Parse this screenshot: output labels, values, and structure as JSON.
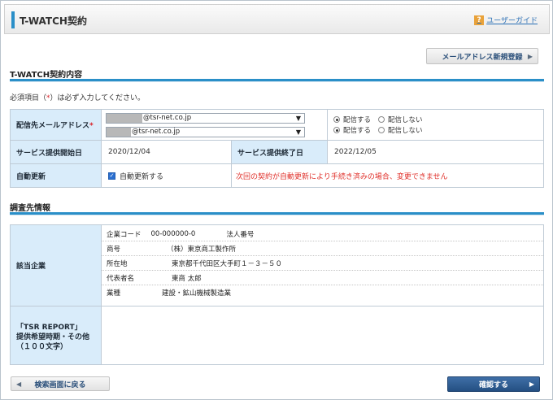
{
  "header": {
    "title": "T-WATCH契約",
    "guide_label": "ユーザーガイド",
    "guide_icon": "?"
  },
  "register_button": "メールアドレス新規登録",
  "contract_section": {
    "title": "T-WATCH契約内容"
  },
  "required_note": {
    "prefix": "必須項目（",
    "mark": "*",
    "suffix": "）は必ず入力してください。"
  },
  "contract_table": {
    "email_label": "配信先メールアドレス",
    "required_mark": "*",
    "emails": [
      {
        "value": "@tsr-net.co.jp",
        "radio_on": "配信する",
        "radio_off": "配信しない"
      },
      {
        "value": "@tsr-net.co.jp",
        "radio_on": "配信する",
        "radio_off": "配信しない"
      }
    ],
    "start_label": "サービス提供開始日",
    "start_value": "2020/12/04",
    "end_label": "サービス提供終了日",
    "end_value": "2022/12/05",
    "auto_label": "自動更新",
    "auto_checkbox_label": "自動更新する",
    "auto_warning": "次回の契約が自動更新により手続き済みの場合、変更できません"
  },
  "survey_section": {
    "title": "調査先情報"
  },
  "company": {
    "label": "該当企業",
    "code_label": "企業コード",
    "code_value": "00-000000-0",
    "corp_no_label": "法人番号",
    "rows": [
      {
        "key": "商号",
        "value": "（株）東京商工製作所"
      },
      {
        "key": "所在地",
        "value": "東京都千代田区大手町１－３－５０"
      },
      {
        "key": "代表者名",
        "value": "東商 太郎"
      },
      {
        "key": "業種",
        "value": "建設・鉱山機械製造業"
      }
    ]
  },
  "tsr_report": {
    "label_line1": "「TSR REPORT」",
    "label_line2": "提供希望時期・その他",
    "label_line3": "（１００文字）"
  },
  "buttons": {
    "back": "検索画面に戻る",
    "confirm": "確認する"
  },
  "colors": {
    "accent": "#2a8fc8",
    "header_cell": "#d9ecfa",
    "warning": "#e0312b",
    "confirm": "#2f5f96"
  }
}
